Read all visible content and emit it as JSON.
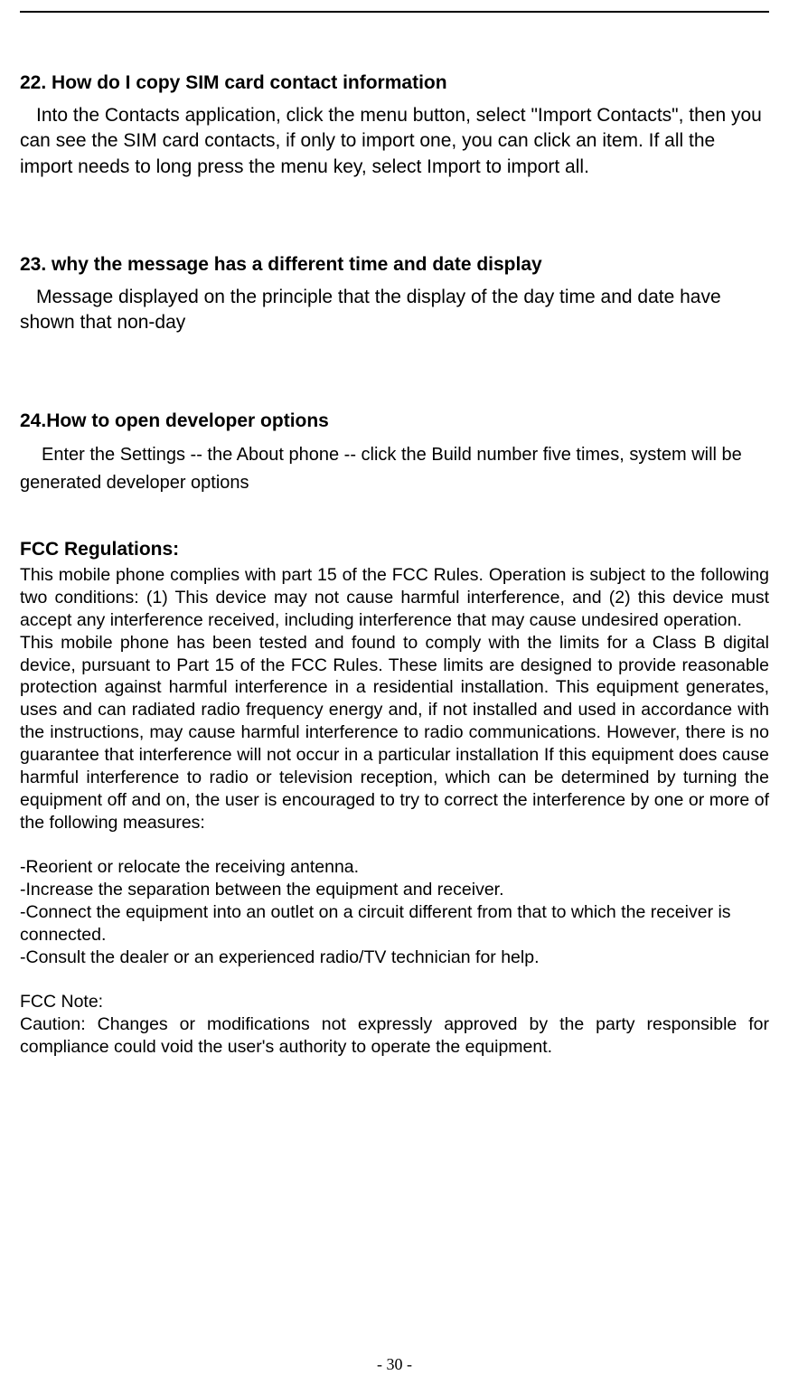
{
  "sections": {
    "s22": {
      "heading": "22. How do I copy SIM card contact information",
      "body": "Into the Contacts application, click the menu button, select \"Import Contacts\", then you can see the SIM card contacts, if only to import one, you can click an item. If all the import needs to long press the menu key, select Import to import all."
    },
    "s23": {
      "heading": "23. why the message has a different time and date display",
      "body": "Message displayed on the principle that the display of the day time and date have shown that non-day"
    },
    "s24": {
      "heading": "24.How to open developer options",
      "body": "Enter the Settings -- the About phone -- click the Build number five times, system will be generated developer options"
    },
    "fcc": {
      "heading": "FCC Regulations:",
      "para1": "This mobile phone complies with part 15 of the FCC Rules. Operation is subject to the following two conditions: (1) This device may not cause harmful interference, and (2) this device must accept any interference received, including interference that may cause undesired operation.",
      "para2": "This mobile phone has been tested and found to comply with the limits for a Class B digital device, pursuant to Part 15 of the FCC Rules. These limits are designed to provide reasonable protection against harmful interference in a residential installation. This equipment generates, uses and can radiated radio frequency energy and, if not installed and used in accordance with the instructions, may cause harmful interference to radio communications. However, there is no guarantee that interference will not occur in a particular installation If this equipment does cause harmful interference to radio or television reception, which can be determined by turning the equipment off and on, the user is encouraged to try to correct the interference by one or more of the following measures:",
      "list": {
        "item1": "-Reorient or relocate the receiving antenna.",
        "item2": "-Increase the separation between the equipment and receiver.",
        "item3": "-Connect the equipment into an outlet on a circuit different from that to which the receiver is connected.",
        "item4": "-Consult the dealer or an experienced radio/TV technician for help."
      },
      "noteLabel": "FCC Note:",
      "noteBody": "Caution: Changes or modifications not expressly approved by the party responsible for compliance could void the user's authority to operate the equipment."
    }
  },
  "pageNumber": "- 30 -"
}
